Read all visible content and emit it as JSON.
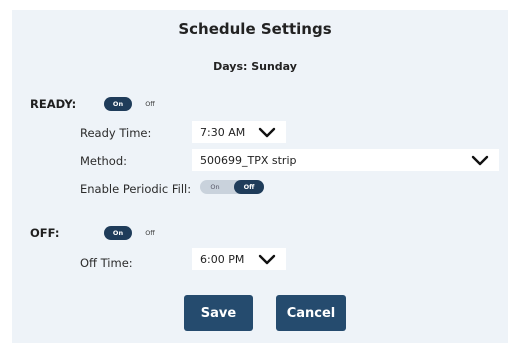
{
  "dialog": {
    "title": "Schedule Settings",
    "days_label": "Days: Sunday"
  },
  "ready": {
    "section_label": "READY:",
    "toggle": {
      "on_label": "On",
      "off_label": "Off",
      "state": "on"
    },
    "ready_time": {
      "label": "Ready Time:",
      "value": "7:30 AM"
    },
    "method": {
      "label": "Method:",
      "value": "500699_TPX strip"
    },
    "periodic_fill": {
      "label": "Enable Periodic Fill:",
      "on_label": "On",
      "off_label": "Off",
      "state": "off"
    }
  },
  "off": {
    "section_label": "OFF:",
    "toggle": {
      "on_label": "On",
      "off_label": "Off",
      "state": "on"
    },
    "off_time": {
      "label": "Off Time:",
      "value": "6:00 PM"
    }
  },
  "buttons": {
    "save_label": "Save",
    "cancel_label": "Cancel"
  },
  "colors": {
    "panel_background": "#eef3f8",
    "button": "#254b6e",
    "toggle_active": "#1f3c5a"
  }
}
